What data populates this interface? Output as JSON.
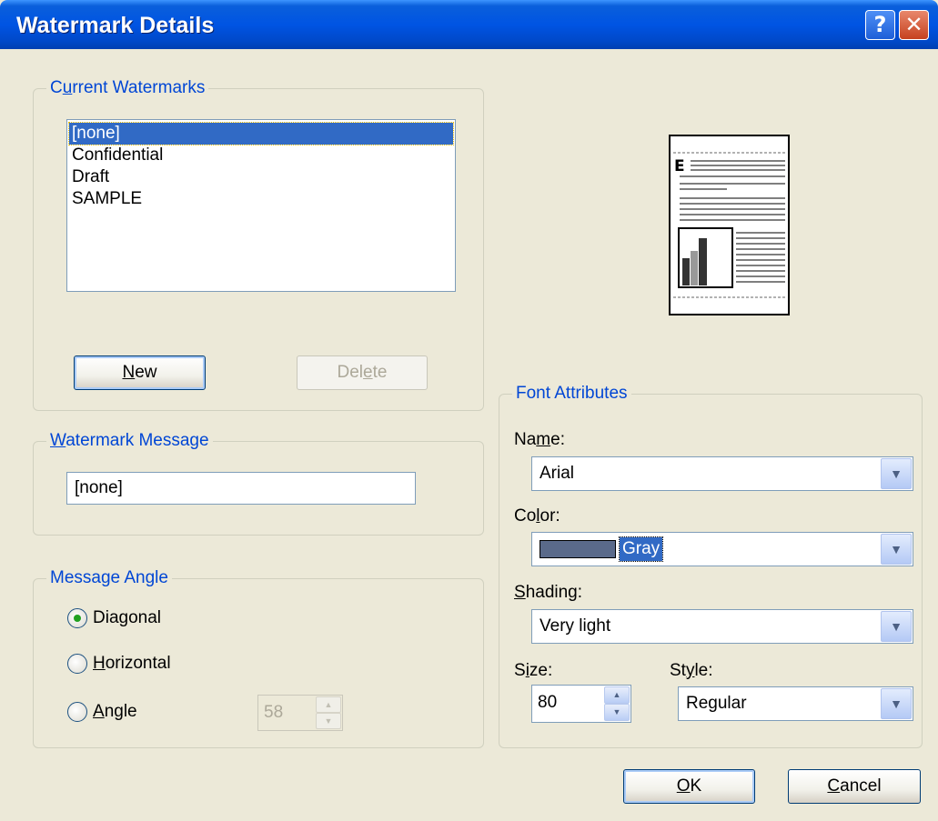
{
  "window": {
    "title": "Watermark Details",
    "help_glyph": "?",
    "close_glyph": "✕"
  },
  "current_watermarks": {
    "title_pre": "C",
    "title_u": "u",
    "title_post": "rrent Watermarks",
    "items": [
      "[none]",
      "Confidential",
      "Draft",
      "SAMPLE"
    ],
    "selected_index": 0,
    "new_u": "N",
    "new_post": "ew",
    "delete_pre": "Del",
    "delete_u": "e",
    "delete_post": "te"
  },
  "watermark_message": {
    "title_u": "W",
    "title_post": "atermark Message",
    "value": "[none]"
  },
  "message_angle": {
    "title": "Message Angle",
    "diagonal": "Diagonal",
    "horizontal_u": "H",
    "horizontal_post": "orizontal",
    "angle_u": "A",
    "angle_post": "ngle",
    "selected": "diagonal",
    "angle_value": "58"
  },
  "font_attributes": {
    "title": "Font Attributes",
    "name_pre": "Na",
    "name_u": "m",
    "name_post": "e:",
    "name_value": "Arial",
    "color_pre": "Co",
    "color_u": "l",
    "color_post": "or:",
    "color_value": "Gray",
    "color_hex": "#5a6a8a",
    "shading_u": "S",
    "shading_post": "hading:",
    "shading_value": "Very light",
    "size_pre": "S",
    "size_u": "i",
    "size_post": "ze:",
    "size_value": "80",
    "style_pre": "St",
    "style_u": "y",
    "style_post": "le:",
    "style_value": "Regular"
  },
  "preview": {
    "heading_letter": "E"
  },
  "dialog_buttons": {
    "ok_u": "O",
    "ok_post": "K",
    "cancel_u": "C",
    "cancel_post": "ancel"
  },
  "icons": {
    "combo_arrow": "chevron-down-icon",
    "spin_up": "spin-up-icon",
    "spin_down": "spin-down-icon"
  },
  "colors": {
    "title_bar": "#0054e3",
    "group_title": "#0046d5",
    "selection": "#316ac5",
    "dialog_bg": "#ece9d8"
  }
}
